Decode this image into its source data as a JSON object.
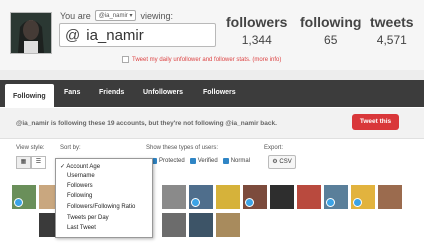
{
  "header": {
    "you_are": "You are",
    "account_select": "@ia_namir ▾",
    "viewing": "viewing:",
    "at": "@",
    "handle": "ia_namir",
    "stats": [
      {
        "label": "followers",
        "value": "1,344"
      },
      {
        "label": "following",
        "value": "65"
      },
      {
        "label": "tweets",
        "value": "4,571"
      }
    ],
    "tweet_stats": "Tweet my daily unfollower and follower stats. (more info)"
  },
  "tabs": [
    "Following",
    "Fans",
    "Friends",
    "Unfollowers",
    "Followers"
  ],
  "info": {
    "text": "@ia_namir is following these 19 accounts, but they're not following @ia_namir back.",
    "tweet_button": "Tweet this"
  },
  "controls": {
    "view_style": "View style:",
    "sort_by": "Sort by:",
    "show_types": "Show these types of users:",
    "export": "Export:",
    "protected": "Protected",
    "verified": "Verified",
    "normal": "Normal",
    "csv": "CSV"
  },
  "sort_options": [
    "✓ Account Age",
    "Username",
    "Followers",
    "Following",
    "Followers/Following Ratio",
    "Tweets per Day",
    "Last Tweet"
  ],
  "colors": {
    "accent_red": "#d9373a",
    "tab_bar": "#3c3c3c",
    "verified_blue": "#3ba3e6"
  }
}
